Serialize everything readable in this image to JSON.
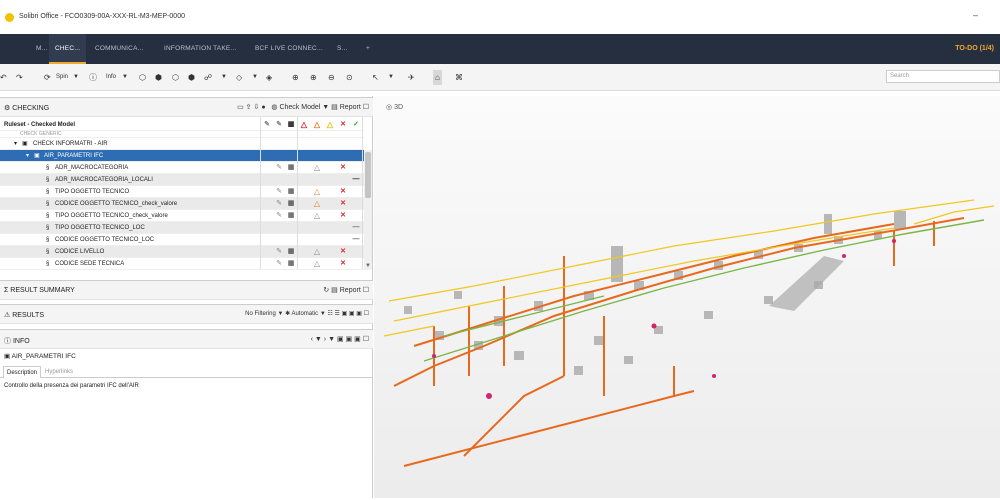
{
  "window": {
    "title": "Solibri Office - FCO0309-00A-XXX-RL-M3-MEP-0000",
    "minimize": "–"
  },
  "tabs": [
    {
      "label": "M..."
    },
    {
      "label": "CHEC..."
    },
    {
      "label": "COMMUNICA..."
    },
    {
      "label": "INFORMATION TAKE..."
    },
    {
      "label": "BCF LIVE CONNEC..."
    },
    {
      "label": "S..."
    },
    {
      "label": "+"
    }
  ],
  "todo": "TO-DO (1/4)",
  "toolbar": {
    "spin": "Spin",
    "info": "Info",
    "search_placeholder": "Search"
  },
  "checking": {
    "title": "CHECKING",
    "check_model": "Check Model",
    "report": "Report",
    "ruleset": "Ruleset - Checked Model",
    "cut_row": "CHECK GENERIC",
    "rows": [
      {
        "label": "CHECK INFORMATRI - AIR"
      },
      {
        "label": "AIR_PARAMETRI IFC"
      },
      {
        "label": "ADR_MACROCATEGORIA"
      },
      {
        "label": "ADR_MACROCATEGORIA_LOCALI"
      },
      {
        "label": "TIPO OGGETTO TECNICO"
      },
      {
        "label": "CODICE OGGETTO TECNICO_check_valore"
      },
      {
        "label": "TIPO OGGETTO TECNICO_check_valore"
      },
      {
        "label": "TIPO OGGETTO TECNICO_LOC"
      },
      {
        "label": "CODICE OGGETTO TECNICO_LOC"
      },
      {
        "label": "CODICE LIVELLO"
      },
      {
        "label": "CODICE SEDE TECNICA"
      }
    ]
  },
  "result_summary": {
    "title": "RESULT SUMMARY",
    "report": "Report"
  },
  "results": {
    "title": "RESULTS",
    "filter": "No Filtering",
    "auto": "Automatic"
  },
  "info": {
    "title": "INFO",
    "item": "AIR_PARAMETRI IFC",
    "tab_description": "Description",
    "tab_hyperlinks": "Hyperlinks",
    "description": "Controllo della presenza dei parametri IFC dell'AIR"
  },
  "viewport": {
    "label": "3D"
  },
  "colors": {
    "tabbar": "#262f3f",
    "accent": "#f0a830",
    "selection": "#2e6db4",
    "error": "#d6242b",
    "warning": "#e07b1d"
  }
}
